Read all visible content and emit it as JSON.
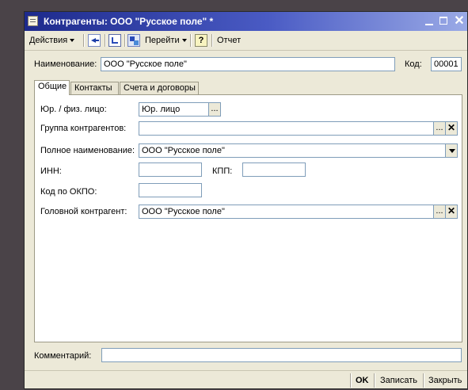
{
  "window": {
    "title": "Контрагенты: ООО \"Русское поле\" *"
  },
  "toolbar": {
    "actions_label": "Действия",
    "goto_label": "Перейти",
    "help_label": "?",
    "report_label": "Отчет"
  },
  "header": {
    "name_label": "Наименование:",
    "name_value": "ООО \"Русское поле\"",
    "code_label": "Код:",
    "code_value": "00001"
  },
  "tabs": [
    {
      "label": "Общие",
      "active": true
    },
    {
      "label": "Контакты",
      "active": false
    },
    {
      "label": "Счета и договоры",
      "active": false
    }
  ],
  "form": {
    "legal_type_label": "Юр. / физ. лицо:",
    "legal_type_value": "Юр. лицо",
    "group_label": "Группа контрагентов:",
    "group_value": "",
    "full_name_label": "Полное наименование:",
    "full_name_value": "ООО \"Русское поле\"",
    "inn_label": "ИНН:",
    "inn_value": "",
    "kpp_label": "КПП:",
    "kpp_value": "",
    "okpo_label": "Код по ОКПО:",
    "okpo_value": "",
    "head_label": "Головной контрагент:",
    "head_value": "ООО \"Русское поле\""
  },
  "comment": {
    "label": "Комментарий:",
    "value": ""
  },
  "footer": {
    "ok_label": "OK",
    "save_label": "Записать",
    "close_label": "Закрыть"
  },
  "buttons": {
    "select_glyph": "...",
    "clear_glyph": "✕"
  },
  "colors": {
    "titlebar": "#1d2a8c",
    "window_bg": "#ece9d8",
    "field_border": "#7f9db9"
  }
}
